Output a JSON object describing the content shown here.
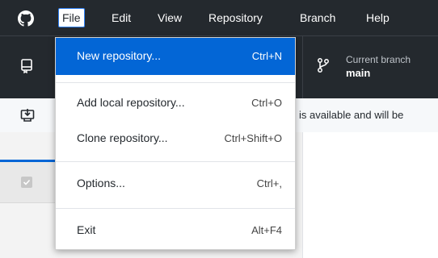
{
  "menubar": {
    "items": [
      "File",
      "Edit",
      "View",
      "Repository",
      "Branch",
      "Help"
    ]
  },
  "toolbar": {
    "branch_label": "Current branch",
    "branch_name": "main"
  },
  "banner": {
    "text": "is available and will be"
  },
  "file_menu": {
    "items": [
      {
        "label": "New repository...",
        "shortcut": "Ctrl+N"
      },
      {
        "label": "Add local repository...",
        "shortcut": "Ctrl+O"
      },
      {
        "label": "Clone repository...",
        "shortcut": "Ctrl+Shift+O"
      },
      {
        "label": "Options...",
        "shortcut": "Ctrl+,"
      },
      {
        "label": "Exit",
        "shortcut": "Alt+F4"
      }
    ]
  },
  "colors": {
    "titlebar": "#24292e",
    "accent": "#0366d6"
  },
  "icons": [
    "github-logo-icon",
    "repository-icon",
    "download-icon",
    "branch-icon",
    "checkbox-icon"
  ]
}
